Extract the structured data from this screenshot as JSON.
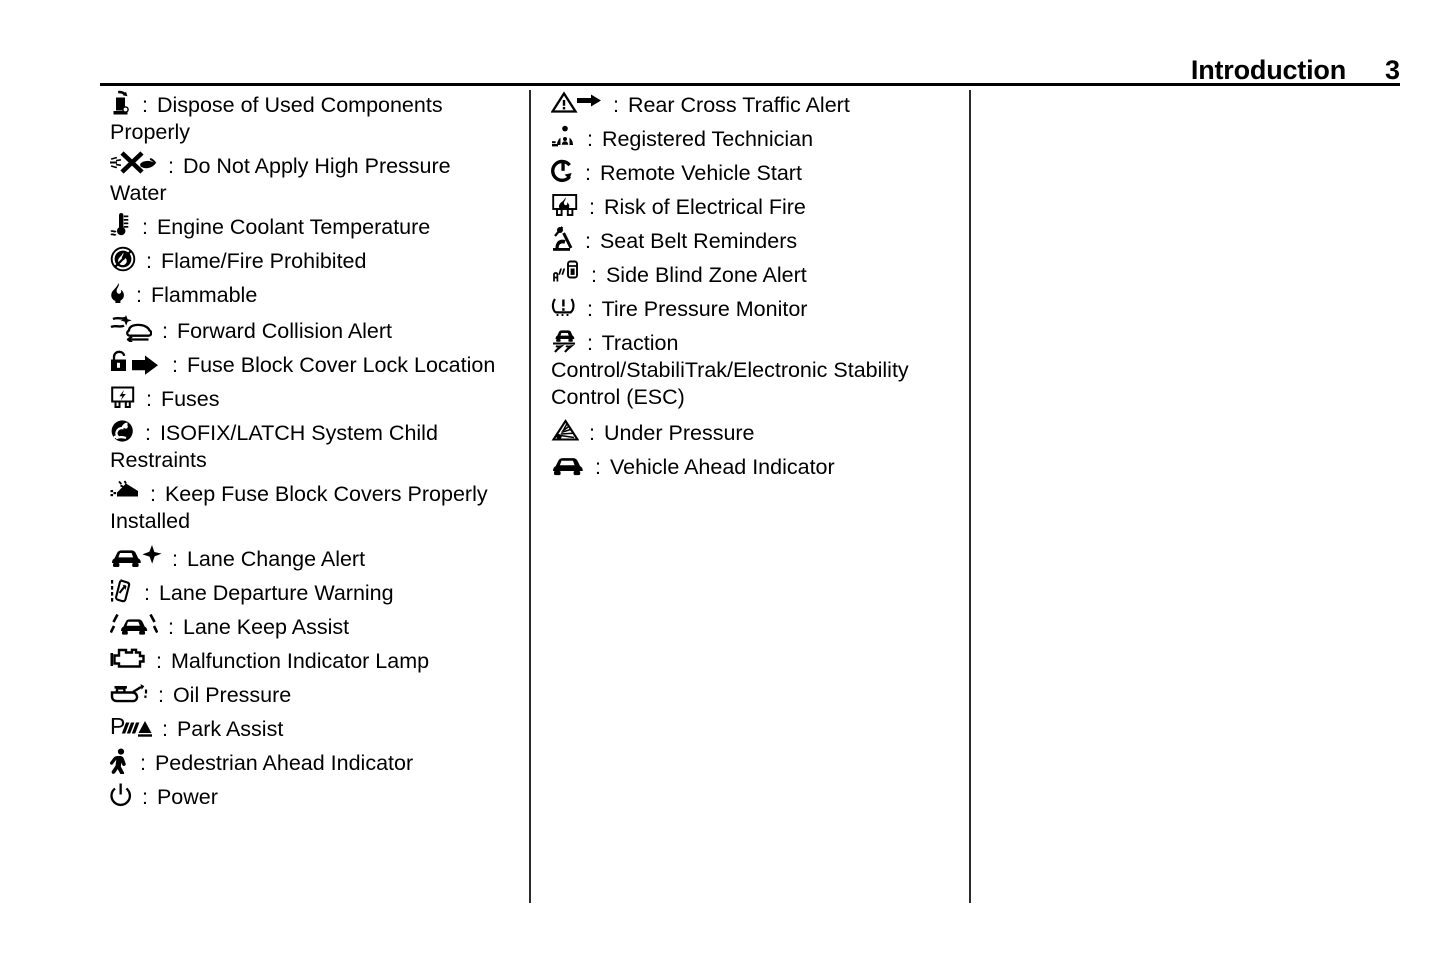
{
  "header": {
    "title": "Introduction",
    "page_number": "3"
  },
  "separator": ":",
  "columns": {
    "left": [
      {
        "icon": "dispose-of-used-components-icon",
        "label": "Dispose of Used Components Properly"
      },
      {
        "icon": "do-not-apply-high-pressure-water-icon",
        "label": "Do Not Apply High Pressure Water"
      },
      {
        "icon": "engine-coolant-temperature-icon",
        "label": "Engine Coolant Temperature"
      },
      {
        "icon": "flame-fire-prohibited-icon",
        "label": "Flame/Fire Prohibited"
      },
      {
        "icon": "flammable-icon",
        "label": "Flammable"
      },
      {
        "icon": "forward-collision-alert-icon",
        "label": "Forward Collision Alert"
      },
      {
        "icon": "fuse-block-cover-lock-location-icon",
        "label": "Fuse Block Cover Lock Location"
      },
      {
        "icon": "fuses-icon",
        "label": "Fuses"
      },
      {
        "icon": "isofix-latch-child-restraints-icon",
        "label": "ISOFIX/LATCH System Child Restraints"
      },
      {
        "icon": "keep-fuse-block-covers-installed-icon",
        "label": "Keep Fuse Block Covers Properly Installed"
      },
      {
        "icon": "lane-change-alert-icon",
        "label": "Lane Change Alert"
      },
      {
        "icon": "lane-departure-warning-icon",
        "label": "Lane Departure Warning"
      },
      {
        "icon": "lane-keep-assist-icon",
        "label": "Lane Keep Assist"
      },
      {
        "icon": "malfunction-indicator-lamp-icon",
        "label": "Malfunction Indicator Lamp"
      },
      {
        "icon": "oil-pressure-icon",
        "label": "Oil Pressure"
      },
      {
        "icon": "park-assist-icon",
        "label": "Park Assist"
      },
      {
        "icon": "pedestrian-ahead-indicator-icon",
        "label": "Pedestrian Ahead Indicator"
      },
      {
        "icon": "power-icon",
        "label": "Power"
      }
    ],
    "right": [
      {
        "icon": "rear-cross-traffic-alert-icon",
        "label": "Rear Cross Traffic Alert"
      },
      {
        "icon": "registered-technician-icon",
        "label": "Registered Technician"
      },
      {
        "icon": "remote-vehicle-start-icon",
        "label": "Remote Vehicle Start"
      },
      {
        "icon": "risk-of-electrical-fire-icon",
        "label": "Risk of Electrical Fire"
      },
      {
        "icon": "seat-belt-reminders-icon",
        "label": "Seat Belt Reminders"
      },
      {
        "icon": "side-blind-zone-alert-icon",
        "label": "Side Blind Zone Alert"
      },
      {
        "icon": "tire-pressure-monitor-icon",
        "label": "Tire Pressure Monitor"
      },
      {
        "icon": "traction-control-stabilitrak-esc-icon",
        "label": "Traction Control/StabiliTrak/Electronic Stability Control (ESC)"
      },
      {
        "icon": "under-pressure-icon",
        "label": "Under Pressure"
      },
      {
        "icon": "vehicle-ahead-indicator-icon",
        "label": "Vehicle Ahead Indicator"
      }
    ],
    "far_right": []
  }
}
